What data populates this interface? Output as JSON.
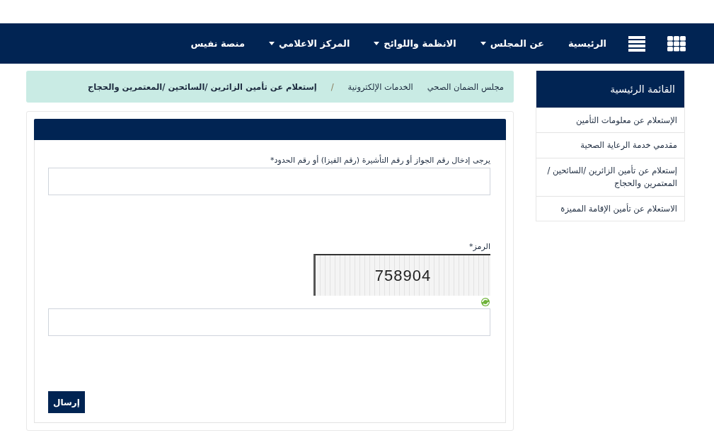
{
  "nav": {
    "items": [
      {
        "label": "الرئيسية",
        "dropdown": false
      },
      {
        "label": "عن المجلس",
        "dropdown": true
      },
      {
        "label": "الانظمة واللوائح",
        "dropdown": true
      },
      {
        "label": "المركز الاعلامي",
        "dropdown": true
      },
      {
        "label": "منصة نفيس",
        "dropdown": false
      }
    ]
  },
  "sidebar": {
    "title": "القائمة الرئيسية",
    "items": [
      "الإستعلام عن معلومات التأمين",
      "مقدمي خدمة الرعاية الصحية",
      "إستعلام عن تأمين الزائرين /السائحين /المعتمرين والحجاج",
      "الاستعلام عن تأمين الإقامة المميزة"
    ]
  },
  "breadcrumb": {
    "items": [
      "مجلس الضمان الصحي",
      "الخدمات الإلكترونية"
    ],
    "separator": "/",
    "current": "إستعلام عن تأمين الزائرين /السائحين /المعتمرين والحجاج"
  },
  "form": {
    "id_label": "يرجى إدخال رقم الجواز أو رقم التأشيرة (رقم الفيزا) أو رقم الحدود*",
    "code_label": "الرمز*",
    "captcha": "758904",
    "submit": "إرسال"
  }
}
